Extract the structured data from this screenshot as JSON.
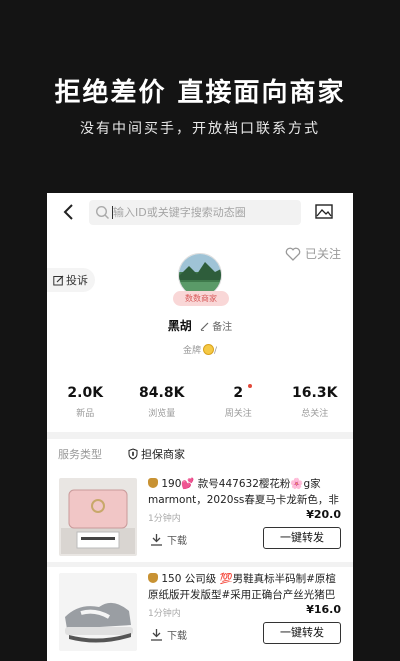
{
  "promo": {
    "headline": "拒绝差价  直接面向商家",
    "subline": "没有中间买手，开放档口联系方式"
  },
  "topbar": {
    "search_placeholder": "输入ID或关键字搜索动态圈",
    "back_icon": "chevron-left-icon",
    "image_icon": "image-icon"
  },
  "profile": {
    "follow_label": "已关注",
    "complain_label": "投诉",
    "badge": "数数商家",
    "name": "黑胡",
    "remark_label": "备注",
    "medal": "金牌"
  },
  "stats": [
    {
      "value": "2.0K",
      "label": "新品"
    },
    {
      "value": "84.8K",
      "label": "浏览量"
    },
    {
      "value": "2",
      "label": "周关注"
    },
    {
      "value": "16.3K",
      "label": "总关注"
    }
  ],
  "tabs": {
    "service": "服务类型",
    "guarantee": "担保商家"
  },
  "products": [
    {
      "description": "190💕 款号447632樱花粉🌸g家marmont，2020ss春夏马卡龙新色，非常…",
      "time": "1分钟内",
      "price": "¥20.0",
      "download_label": "下载",
      "forward_label": "一键转发"
    },
    {
      "description": "150 公司级 💯男鞋真标半码制#原楦原纸版开发版型#采用正确台产丝光猪巴革麂皮…",
      "time": "1分钟内",
      "price": "¥16.0",
      "download_label": "下载",
      "forward_label": "一键转发"
    }
  ],
  "colors": {
    "background": "#141414",
    "accent_red": "#e2493a",
    "badge_pink": "#f9d7d7"
  }
}
